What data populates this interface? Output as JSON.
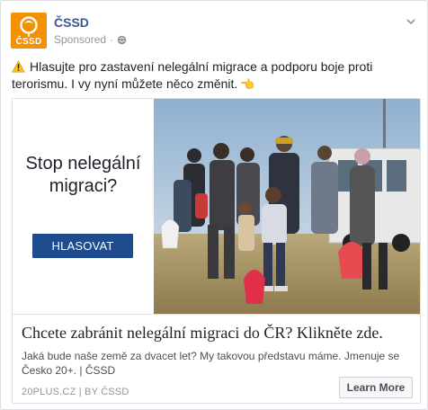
{
  "post": {
    "page_name": "ČSSD",
    "logo_text": "ČSSD",
    "sponsored_label": "Sponsored",
    "separator": "·",
    "text": "Hlasujte pro zastavení nelegální migrace a podporu boje proti terorismu. I vy nyní můžete něco změnit.",
    "hand_emoji": "👈"
  },
  "creative": {
    "headline": "Stop nelegální migraci?",
    "vote_button": "HLASOVAT"
  },
  "link": {
    "title": "Chcete zabránit nelegální migraci do ČR? Klikněte zde.",
    "description": "Jaká bude naše země za dvacet let? My takovou představu máme. Jmenuje se Česko 20+. | ČSSD",
    "domain": "20PLUS.CZ | BY ČSSD",
    "cta": "Learn More"
  },
  "colors": {
    "brand_orange": "#f29101",
    "button_blue": "#1e4c8f",
    "link_blue": "#365899"
  }
}
